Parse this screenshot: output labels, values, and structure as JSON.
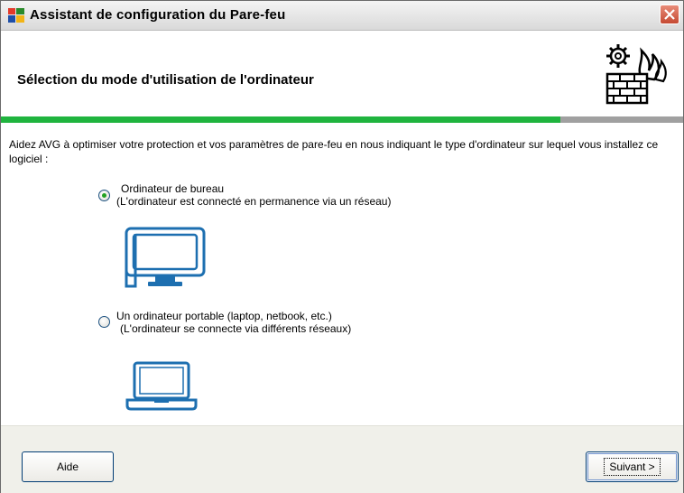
{
  "window": {
    "title": "Assistant de configuration du Pare-feu"
  },
  "header": {
    "title": "Sélection du mode d'utilisation de l'ordinateur"
  },
  "progress": {
    "fraction": 0.82,
    "color": "#1fb43e"
  },
  "intro": "Aidez AVG à optimiser votre protection et vos paramètres de pare-feu en nous indiquant le type d'ordinateur sur lequel vous installez ce logiciel :",
  "options": [
    {
      "label": "Ordinateur de bureau",
      "description": "(L'ordinateur est connecté en permanence via un réseau)",
      "selected": true,
      "icon": "desktop-monitor-icon"
    },
    {
      "label": "Un ordinateur portable (laptop, netbook, etc.)",
      "description": "(L'ordinateur se connecte via différents réseaux)",
      "selected": false,
      "icon": "laptop-icon"
    }
  ],
  "buttons": {
    "help": "Aide",
    "next": "Suivant >"
  },
  "colors": {
    "accent": "#1fb43e",
    "icon_blue": "#1d6fb0",
    "footer": "#f0f0ea"
  }
}
